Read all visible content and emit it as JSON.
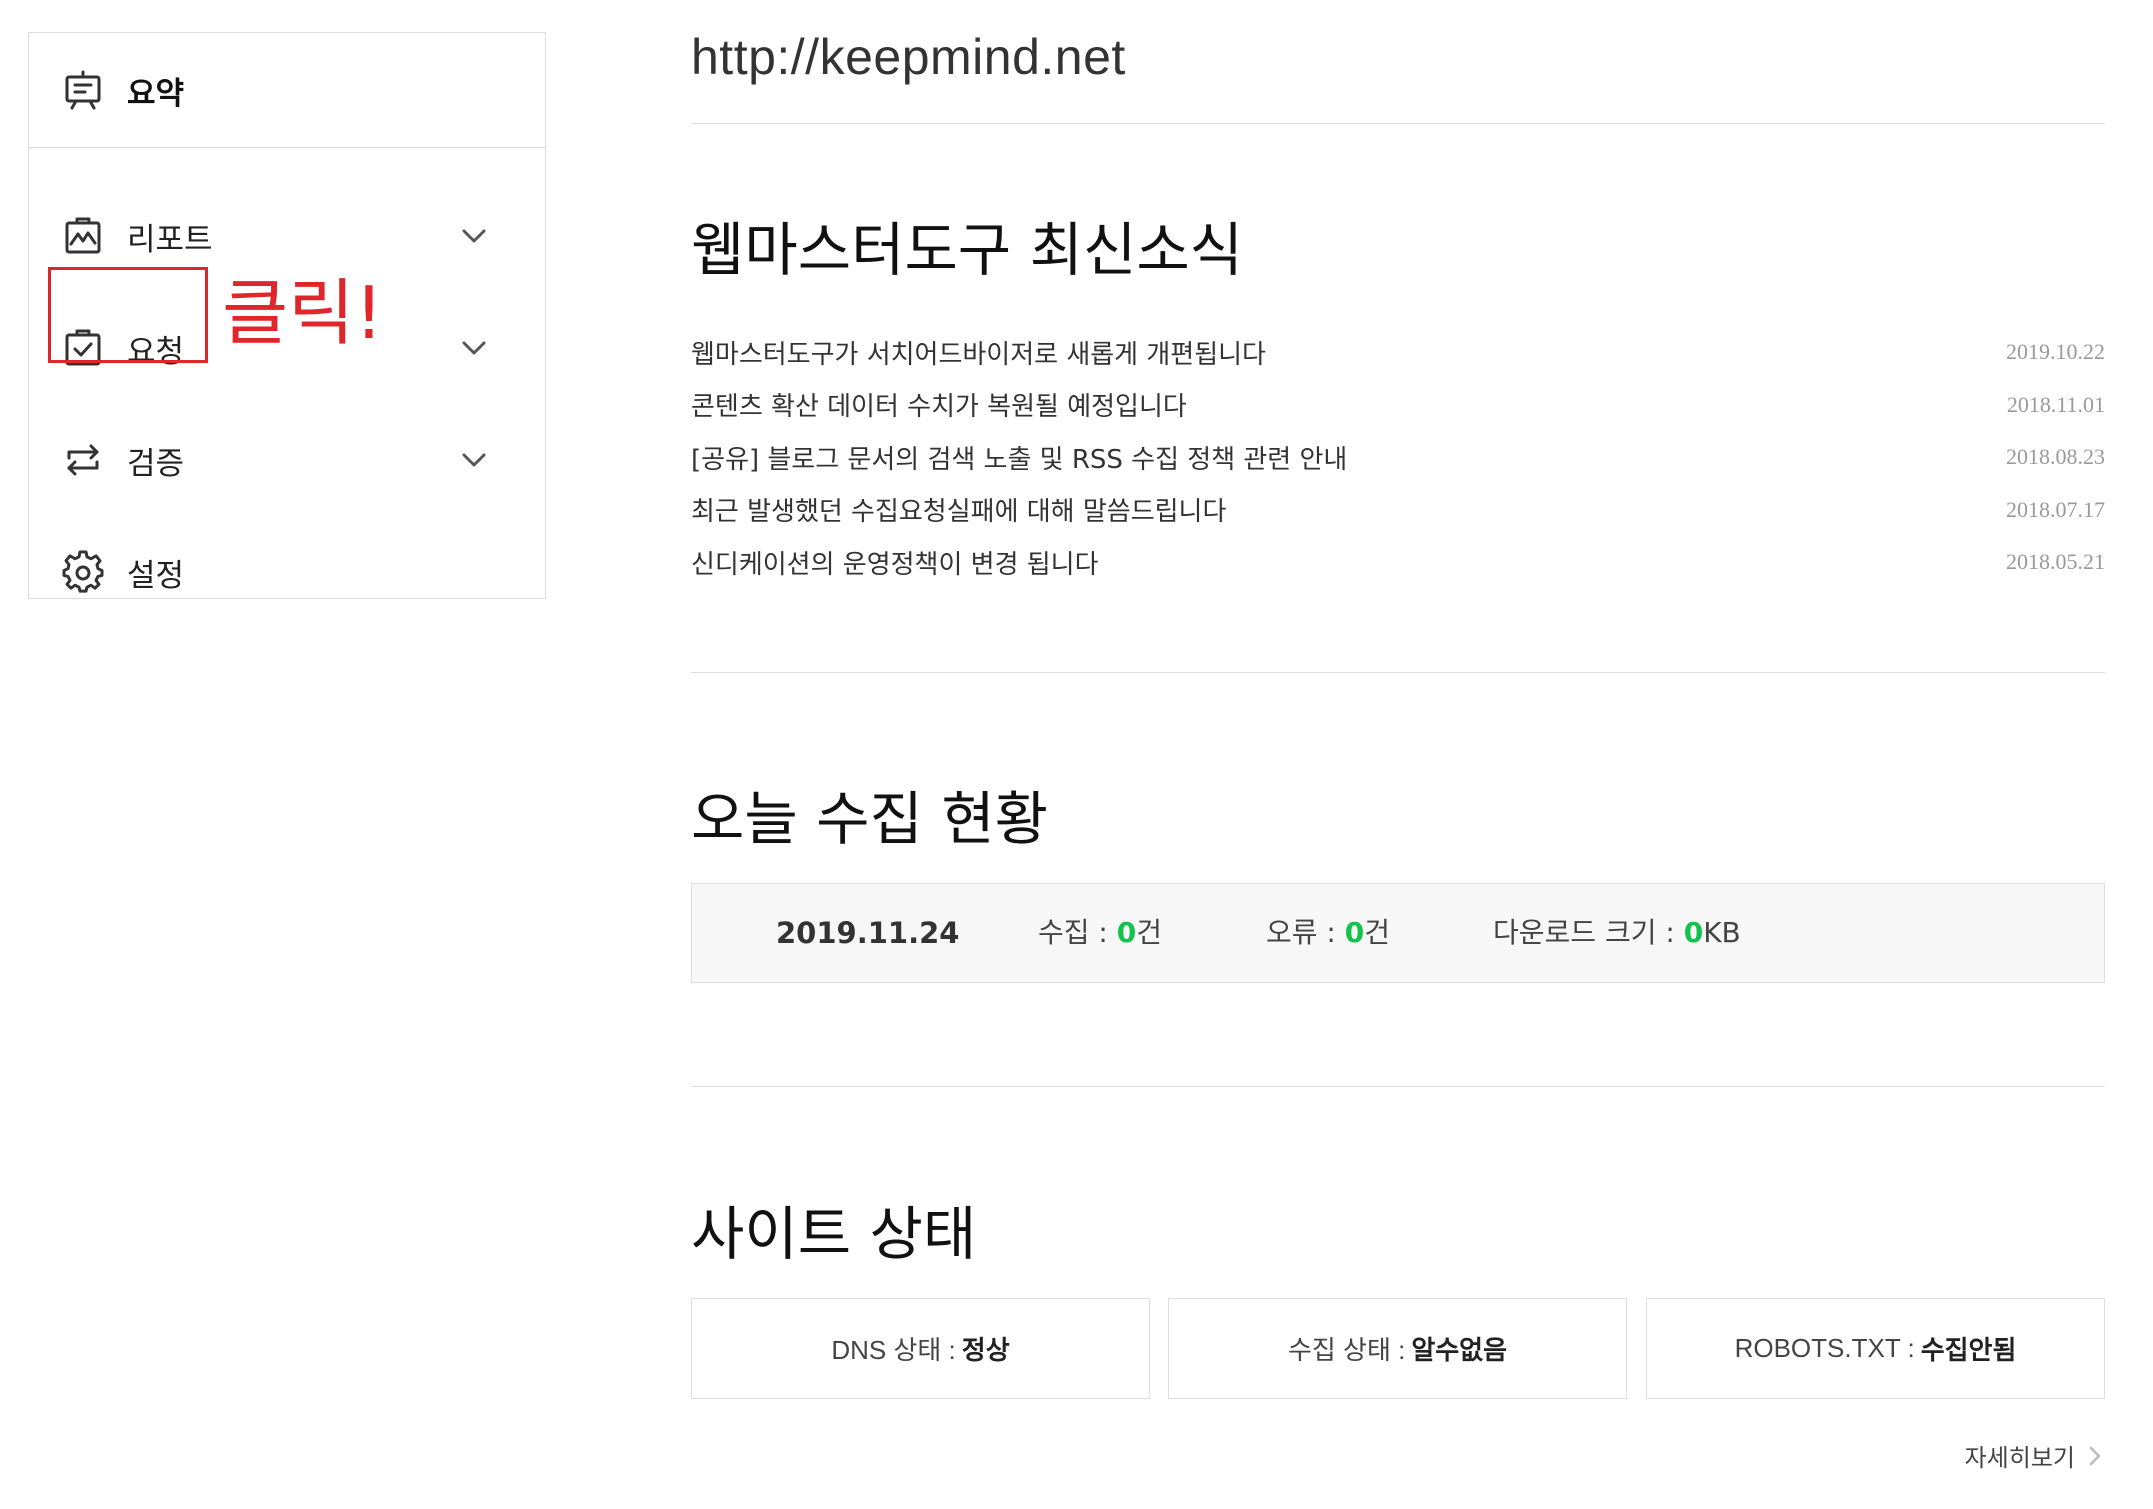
{
  "sidebar": {
    "summary": {
      "label": "요약",
      "icon": "presentation-icon"
    },
    "items": [
      {
        "label": "리포트",
        "icon": "report-chart-icon"
      },
      {
        "label": "요청",
        "icon": "clipboard-check-icon"
      },
      {
        "label": "검증",
        "icon": "repeat-arrows-icon"
      },
      {
        "label": "설정",
        "icon": "gear-icon"
      }
    ]
  },
  "annotation": {
    "text": "클릭!",
    "color": "#e0262b"
  },
  "site": {
    "url": "http://keepmind.net"
  },
  "news": {
    "title": "웹마스터도구 최신소식",
    "items": [
      {
        "title": "웹마스터도구가 서치어드바이저로 새롭게 개편됩니다",
        "date": "2019.10.22"
      },
      {
        "title": "콘텐츠 확산 데이터 수치가 복원될 예정입니다",
        "date": "2018.11.01"
      },
      {
        "title": "[공유] 블로그 문서의 검색 노출 및 RSS 수집 정책 관련 안내",
        "date": "2018.08.23"
      },
      {
        "title": "최근 발생했던 수집요청실패에 대해 말씀드립니다",
        "date": "2018.07.17"
      },
      {
        "title": "신디케이션의 운영정책이 변경 됩니다",
        "date": "2018.05.21"
      }
    ]
  },
  "today": {
    "title": "오늘 수집 현황",
    "date": "2019.11.24",
    "collect_label": "수집 : ",
    "collect_value": "0",
    "collect_unit": "건",
    "error_label": "오류 : ",
    "error_value": "0",
    "error_unit": "건",
    "download_label": "다운로드 크기 : ",
    "download_value": "0",
    "download_unit": "KB",
    "accent_color": "#10c34a"
  },
  "status": {
    "title": "사이트 상태",
    "cards": [
      {
        "label": "DNS 상태 :",
        "value": "정상"
      },
      {
        "label": "수집 상태 :",
        "value": "알수없음"
      },
      {
        "label": "ROBOTS.TXT :",
        "value": "수집안됨"
      }
    ],
    "more_label": "자세히보기"
  }
}
